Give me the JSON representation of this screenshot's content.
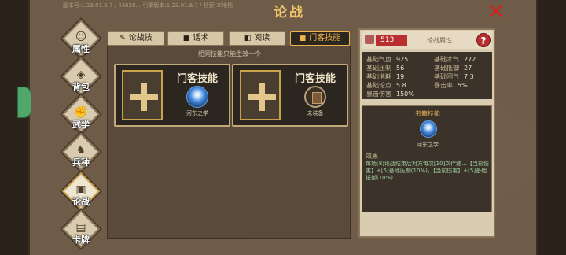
{
  "header": {
    "title": "论战",
    "version_text": "版本号:1.23.01.6.7 / 43628... 引擎版本:1.23.01.6.7 / 档案:本地档"
  },
  "nav": [
    {
      "label": "属性",
      "icon": "person-icon"
    },
    {
      "label": "背包",
      "icon": "bag-icon"
    },
    {
      "label": "武学",
      "icon": "fist-icon"
    },
    {
      "label": "兵种",
      "icon": "horse-icon"
    },
    {
      "label": "论战",
      "icon": "chat-icon",
      "active": true
    },
    {
      "label": "卡牌",
      "icon": "card-icon"
    }
  ],
  "tabs": [
    {
      "label": "论战技",
      "icon": "brush-icon"
    },
    {
      "label": "话术",
      "icon": "speech-icon"
    },
    {
      "label": "阅读",
      "icon": "book-icon"
    },
    {
      "label": "门客技能",
      "icon": "speech-icon",
      "active": true
    }
  ],
  "left": {
    "hint": "相同技能只能生效一个",
    "cards": [
      {
        "title": "门客技能",
        "skill_name": "河东之学",
        "skill_icon": "blue-orb-icon"
      },
      {
        "title": "门客技能",
        "skill_name": "未装备",
        "skill_icon": "book-icon"
      }
    ]
  },
  "right": {
    "level": "513",
    "attr_title": "论战属性",
    "help": "?",
    "stats": [
      {
        "label": "基础气血",
        "value": "925"
      },
      {
        "label": "基础才气",
        "value": "272"
      },
      {
        "label": "基础压制",
        "value": "56"
      },
      {
        "label": "基础抵御",
        "value": "27"
      },
      {
        "label": "基础消耗",
        "value": "19"
      },
      {
        "label": "基础回气",
        "value": "7.3"
      },
      {
        "label": "基础论点",
        "value": "5.8"
      },
      {
        "label": "暴击率",
        "value": "5%"
      },
      {
        "label": "暴击伤害",
        "value": "150%"
      }
    ],
    "book": {
      "title": "书籍技能",
      "name": "河东之学",
      "effect_label": "效果",
      "effect_text": "每场[8]论战结束后对方每次[10]次伴随...【当前伤害】+[5]基础压制(10%)，【当前伤害】+[5]基础抵御(10%)"
    }
  },
  "colors": {
    "accent": "#f0b24a",
    "close": "#d41f1f",
    "level_bg": "#b92e2e"
  }
}
